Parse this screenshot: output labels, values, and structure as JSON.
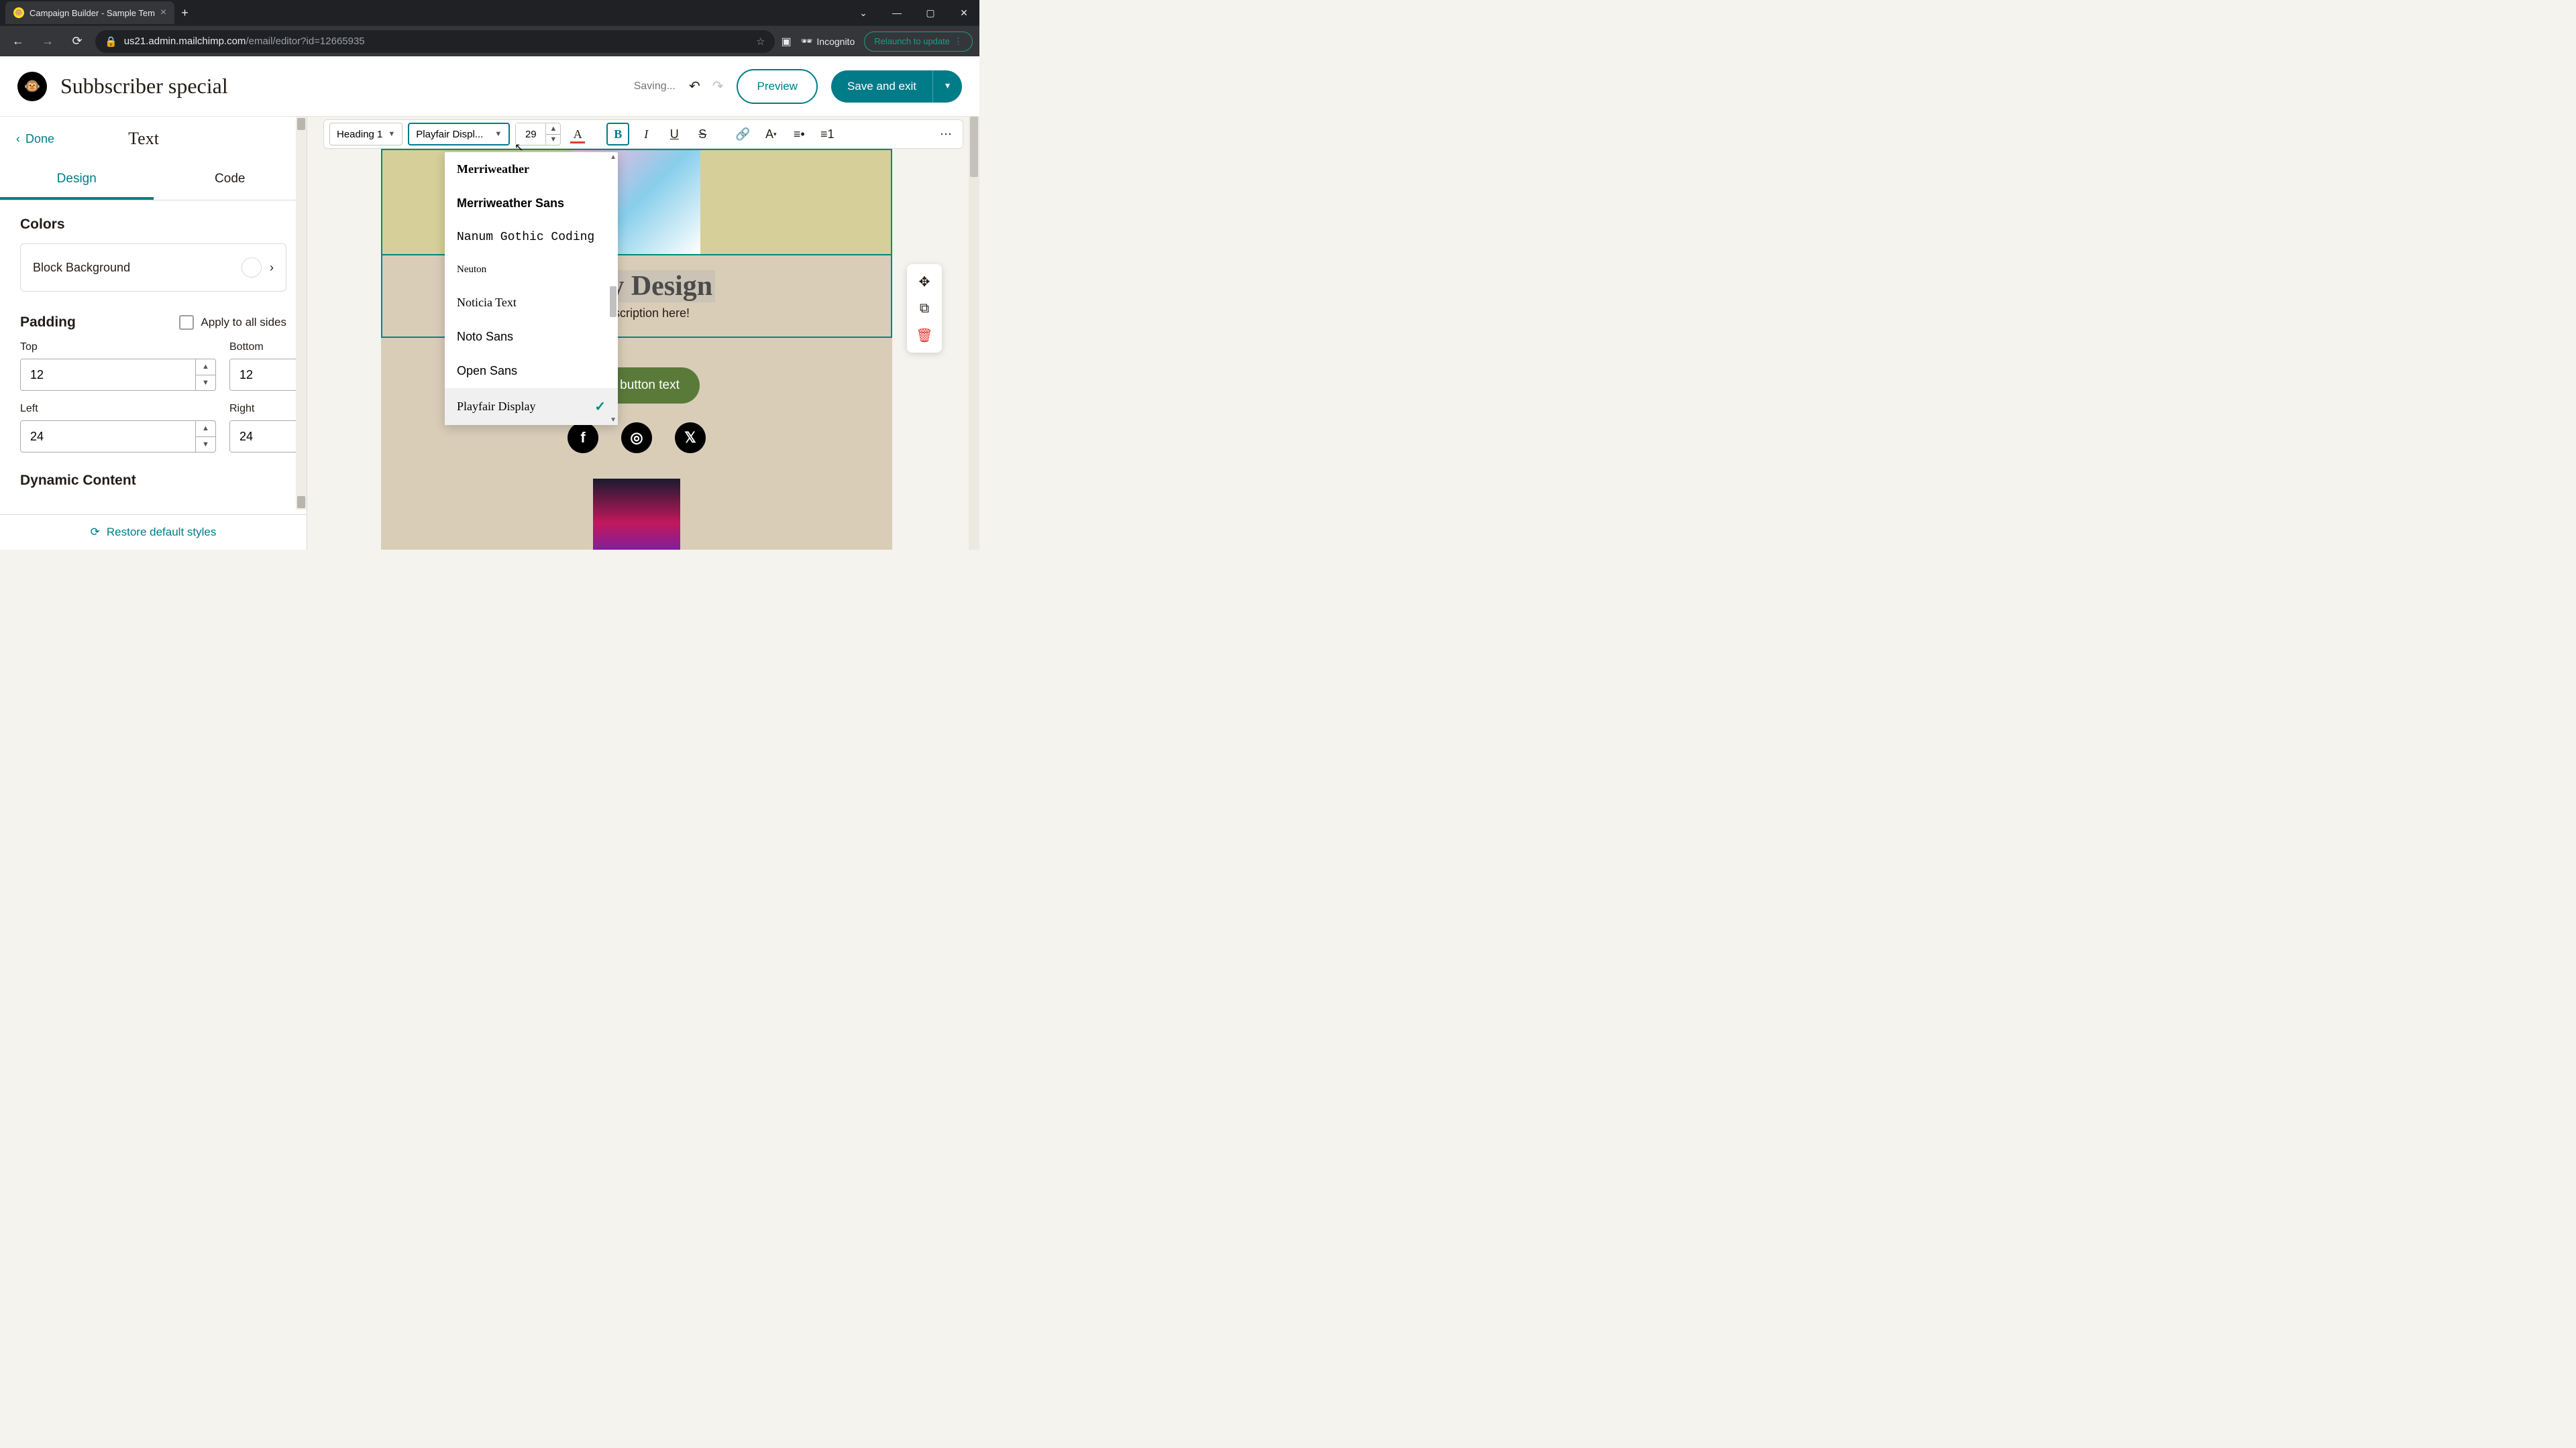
{
  "browser": {
    "tab_title": "Campaign Builder - Sample Tem",
    "url_host": "us21.admin.mailchimp.com",
    "url_path": "/email/editor?id=12665935",
    "incognito": "Incognito",
    "relaunch": "Relaunch to update"
  },
  "header": {
    "title": "Subbscriber special",
    "saving": "Saving...",
    "preview": "Preview",
    "save": "Save and exit"
  },
  "sidebar": {
    "done": "Done",
    "panel_title": "Text",
    "tab_design": "Design",
    "tab_code": "Code",
    "colors_h": "Colors",
    "block_bg": "Block Background",
    "padding_h": "Padding",
    "apply_all": "Apply to all sides",
    "top": "Top",
    "bottom": "Bottom",
    "left": "Left",
    "right": "Right",
    "val_top": "12",
    "val_bottom": "12",
    "val_left": "24",
    "val_right": "24",
    "dynamic": "Dynamic Content",
    "restore": "Restore default styles"
  },
  "toolbar": {
    "style": "Heading 1",
    "font": "Playfair Displ...",
    "size": "29"
  },
  "font_dropdown": {
    "opts": [
      {
        "label": "Merriweather",
        "font": "Georgia, serif",
        "weight": "bold"
      },
      {
        "label": "Merriweather Sans",
        "font": "Arial, sans-serif",
        "weight": "bold"
      },
      {
        "label": "Nanum Gothic Coding",
        "font": "'Courier New', monospace",
        "weight": "normal"
      },
      {
        "label": "Neuton",
        "font": "Georgia, serif",
        "weight": "normal",
        "size": "15px"
      },
      {
        "label": "Noticia Text",
        "font": "Georgia, serif",
        "weight": "normal"
      },
      {
        "label": "Noto Sans",
        "font": "Arial, sans-serif",
        "weight": "normal"
      },
      {
        "label": "Open Sans",
        "font": "Arial, sans-serif",
        "weight": "normal"
      },
      {
        "label": "Playfair Display",
        "font": "Georgia, serif",
        "weight": "normal",
        "selected": true
      }
    ]
  },
  "email": {
    "heading": "is my Design",
    "desc": "he description here!",
    "button": "Add button text"
  }
}
